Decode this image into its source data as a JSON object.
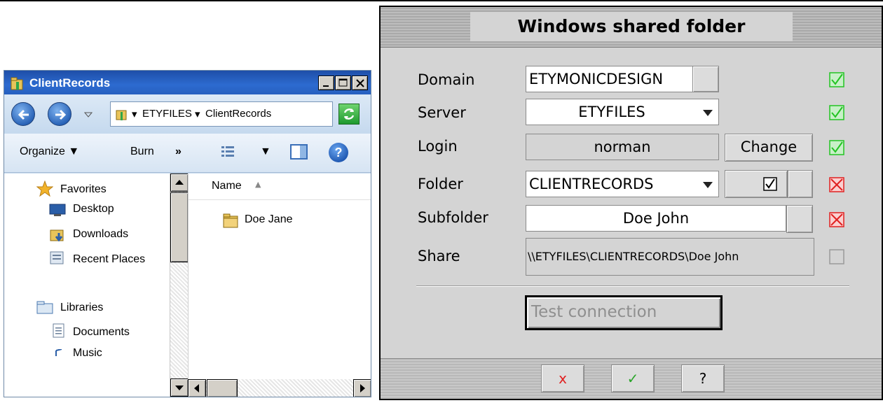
{
  "explorer": {
    "title": "ClientRecords",
    "address": {
      "segments": [
        "ETYFILES",
        "ClientRecords"
      ]
    },
    "toolbar": {
      "organize": "Organize",
      "burn": "Burn",
      "more": "»"
    },
    "nav": {
      "favorites": "Favorites",
      "desktop": "Desktop",
      "downloads": "Downloads",
      "recent": "Recent Places",
      "libraries": "Libraries",
      "documents": "Documents",
      "music_partial": "Music"
    },
    "column_header": "Name",
    "files": [
      "Doe Jane"
    ]
  },
  "dialog": {
    "title": "Windows shared folder",
    "domain": {
      "label": "Domain",
      "value": "ETYMONICDESIGN",
      "status": "ok"
    },
    "server": {
      "label": "Server",
      "value": "ETYFILES",
      "status": "ok"
    },
    "login": {
      "label": "Login",
      "value": "norman",
      "button": "Change",
      "status": "ok"
    },
    "folder": {
      "label": "Folder",
      "value": "CLIENTRECORDS",
      "checkbox_checked": true,
      "status": "error"
    },
    "subfolder": {
      "label": "Subfolder",
      "value": "Doe John",
      "status": "error"
    },
    "share": {
      "label": "Share",
      "value": "\\\\ETYFILES\\CLIENTRECORDS\\Doe John",
      "status": "none"
    },
    "test_button": "Test connection",
    "footer": {
      "cancel": "x",
      "ok": "✓",
      "help": "?"
    }
  },
  "colors": {
    "ok": "#22c422",
    "error": "#e02020",
    "title_blue": "#2d6bd0"
  }
}
